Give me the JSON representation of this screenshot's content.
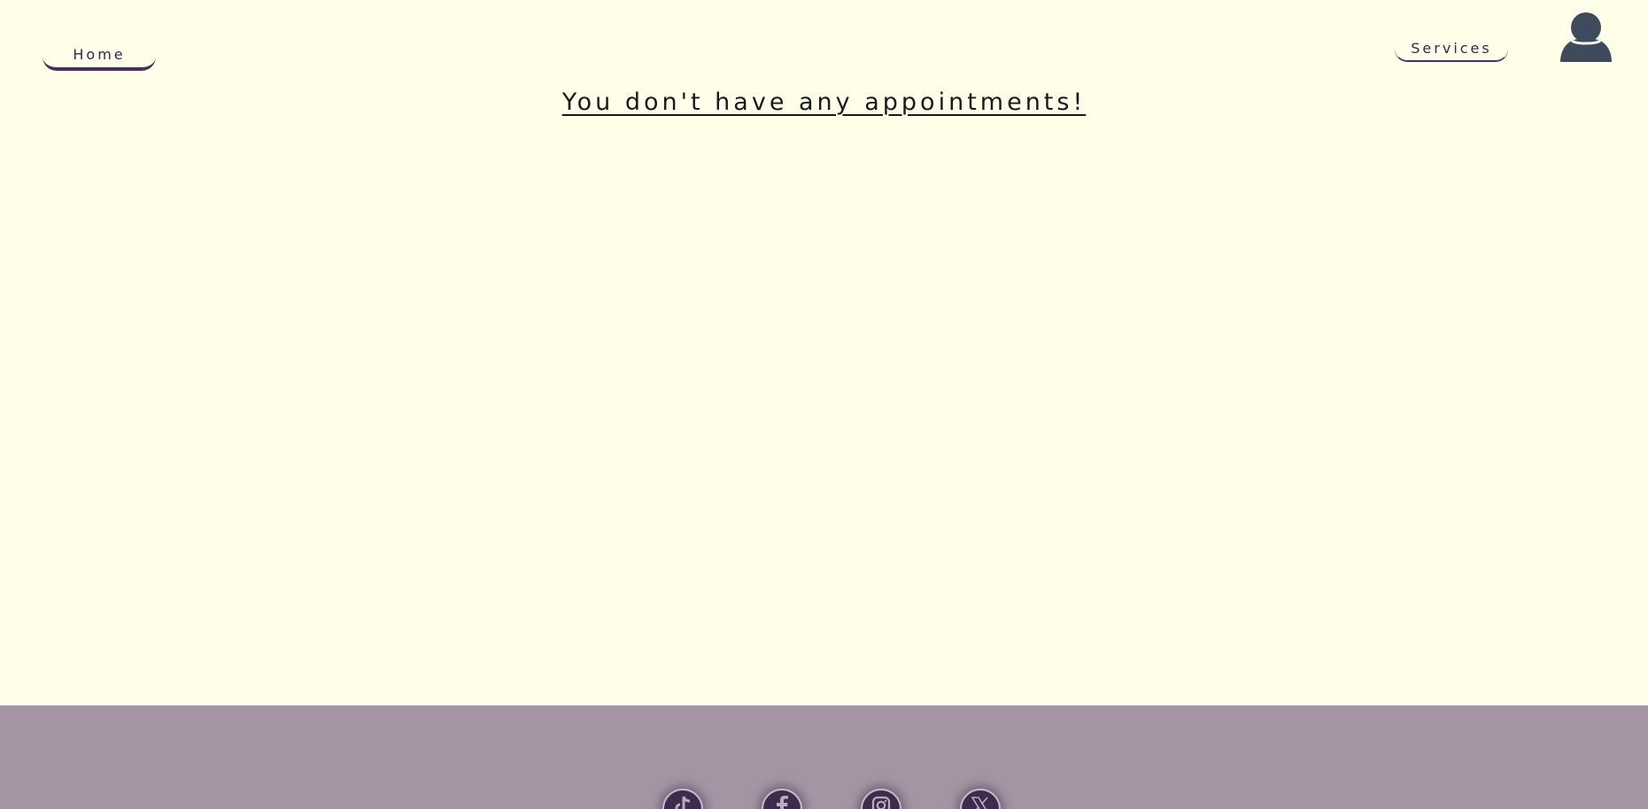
{
  "header": {
    "home_label": "Home",
    "services_label": "Services",
    "avatar_icon": "user-icon"
  },
  "main": {
    "empty_message": "You don't have any appointments!"
  },
  "footer": {
    "social_icons": [
      "tiktok-icon",
      "facebook-icon",
      "instagram-icon",
      "x-icon"
    ]
  },
  "colors": {
    "background": "#fefee9",
    "accent": "#4b2e5e",
    "footer": "#a594a3",
    "avatar": "#3d4b5c"
  }
}
